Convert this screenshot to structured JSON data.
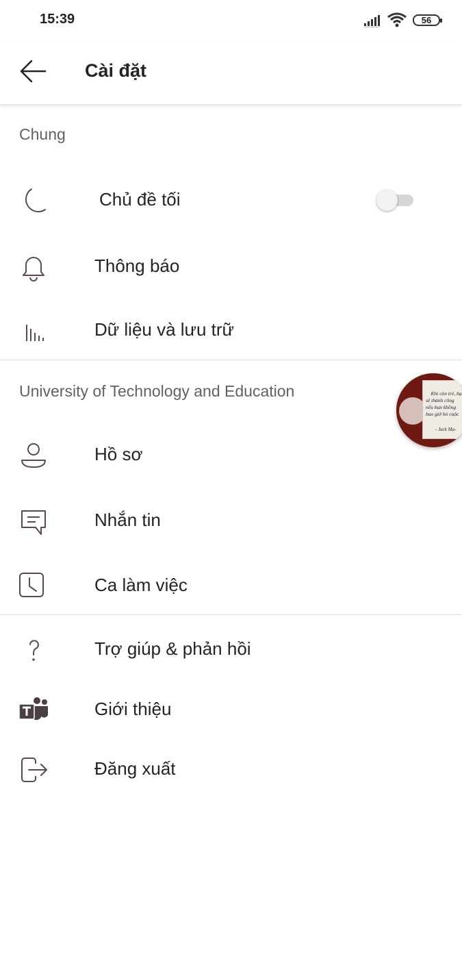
{
  "status_bar": {
    "time": "15:39",
    "battery": "56"
  },
  "header": {
    "title": "Cài đặt"
  },
  "sections": {
    "general": {
      "header": "Chung",
      "dark_theme_label": "Chủ đề tối",
      "dark_theme_enabled": false,
      "notifications_label": "Thông báo",
      "data_storage_label": "Dữ liệu và lưu trữ"
    },
    "org": {
      "header": "University of Technology and Education",
      "profile_label": "Hồ sơ",
      "messaging_label": "Nhắn tin",
      "shifts_label": "Ca làm việc"
    },
    "other": {
      "help_label": "Trợ giúp & phản hồi",
      "about_label": "Giới thiệu",
      "signout_label": "Đăng xuất"
    }
  },
  "bubble": {
    "quote": "Khi còn trẻ, bạn\nsẽ thành công\nnếu bạn không\nbao giờ bỏ cuộc",
    "author": "- Jack Ma-"
  },
  "colors": {
    "icon": "#5a4a4e",
    "section_text": "#616161",
    "teams_brand": "#4b3e45"
  },
  "icons": {
    "back": "arrow-left-icon",
    "dark_theme": "moon-icon",
    "notifications": "bell-icon",
    "data": "bar-chart-icon",
    "profile": "person-icon",
    "messaging": "chat-icon",
    "shifts": "clock-icon",
    "help": "question-icon",
    "about": "teams-logo-icon",
    "signout": "sign-out-icon"
  }
}
